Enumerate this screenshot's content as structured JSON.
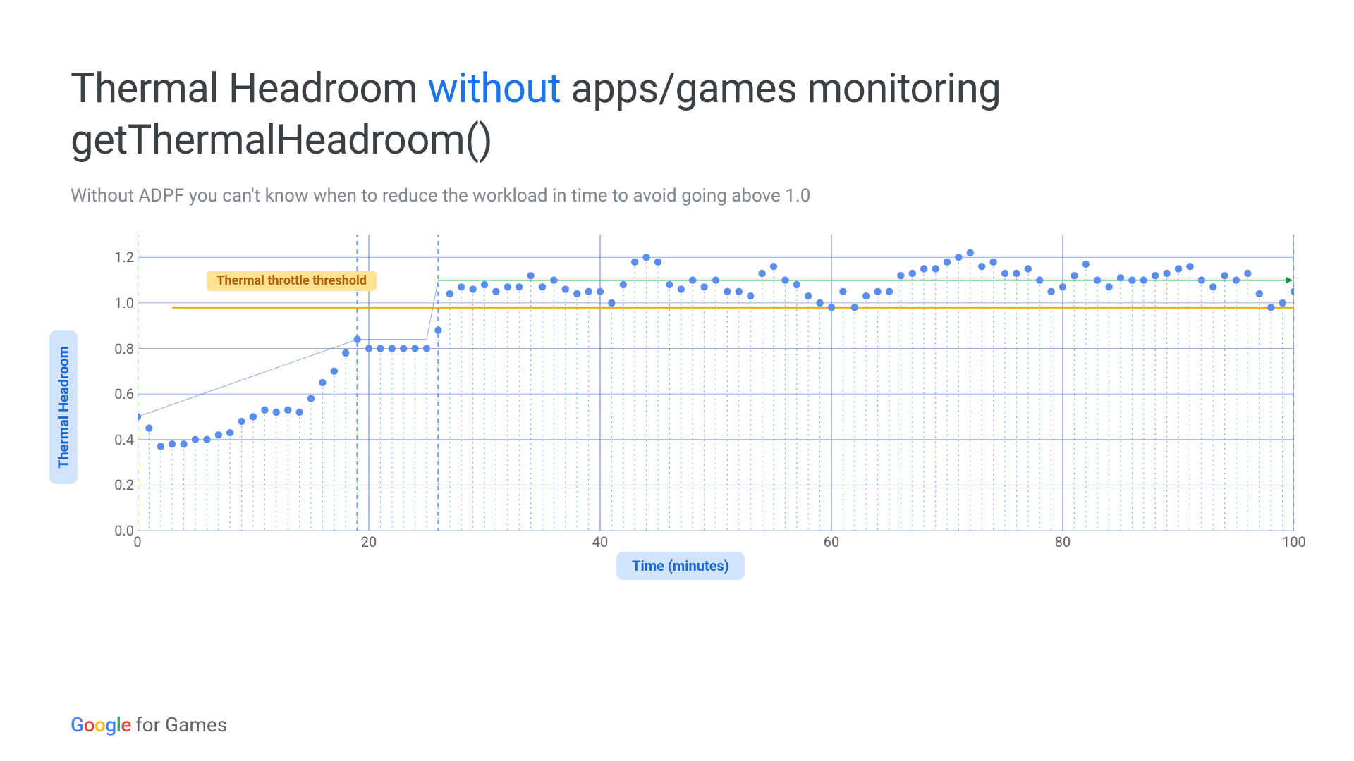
{
  "title_parts": {
    "pre": "Thermal Headroom ",
    "accent": "without",
    "post": " apps/games monitoring getThermalHeadroom()"
  },
  "subtitle": "Without ADPF you can't know when to reduce the workload in time to avoid going above 1.0",
  "ylabel": "Thermal Headroom",
  "xlabel": "Time (minutes)",
  "annotation": "Thermal throttle threshold",
  "footer_brand": "Google",
  "footer_text": " for Games",
  "chart_data": {
    "type": "scatter",
    "xlabel": "Time (minutes)",
    "ylabel": "Thermal Headroom",
    "xlim": [
      0,
      100
    ],
    "ylim": [
      0.0,
      1.3
    ],
    "x_ticks": [
      0,
      20,
      40,
      60,
      80,
      100
    ],
    "y_ticks": [
      0.0,
      0.2,
      0.4,
      0.6,
      0.8,
      1.0,
      1.2
    ],
    "x_vgrid": [
      0,
      20,
      40,
      60,
      80,
      100
    ],
    "phase_boundaries": [
      0,
      19,
      26,
      100
    ],
    "threshold_throttle_y": 0.98,
    "threshold_green_y": 1.1,
    "values": [
      0.5,
      0.45,
      0.37,
      0.38,
      0.38,
      0.4,
      0.4,
      0.42,
      0.43,
      0.48,
      0.5,
      0.53,
      0.52,
      0.53,
      0.52,
      0.58,
      0.65,
      0.7,
      0.78,
      0.84,
      0.8,
      0.8,
      0.8,
      0.8,
      0.8,
      0.8,
      0.88,
      1.04,
      1.07,
      1.06,
      1.08,
      1.05,
      1.07,
      1.07,
      1.12,
      1.07,
      1.1,
      1.06,
      1.04,
      1.05,
      1.05,
      1.0,
      1.08,
      1.18,
      1.2,
      1.18,
      1.08,
      1.06,
      1.1,
      1.07,
      1.1,
      1.05,
      1.05,
      1.03,
      1.13,
      1.16,
      1.1,
      1.08,
      1.03,
      1.0,
      0.98,
      1.05,
      0.98,
      1.03,
      1.05,
      1.05,
      1.12,
      1.13,
      1.15,
      1.15,
      1.18,
      1.2,
      1.22,
      1.16,
      1.18,
      1.13,
      1.13,
      1.15,
      1.1,
      1.05,
      1.07,
      1.12,
      1.17,
      1.1,
      1.07,
      1.11,
      1.1,
      1.1,
      1.12,
      1.13,
      1.15,
      1.16,
      1.1,
      1.07,
      1.12,
      1.1,
      1.13,
      1.04,
      0.98,
      1.0,
      1.05
    ]
  }
}
